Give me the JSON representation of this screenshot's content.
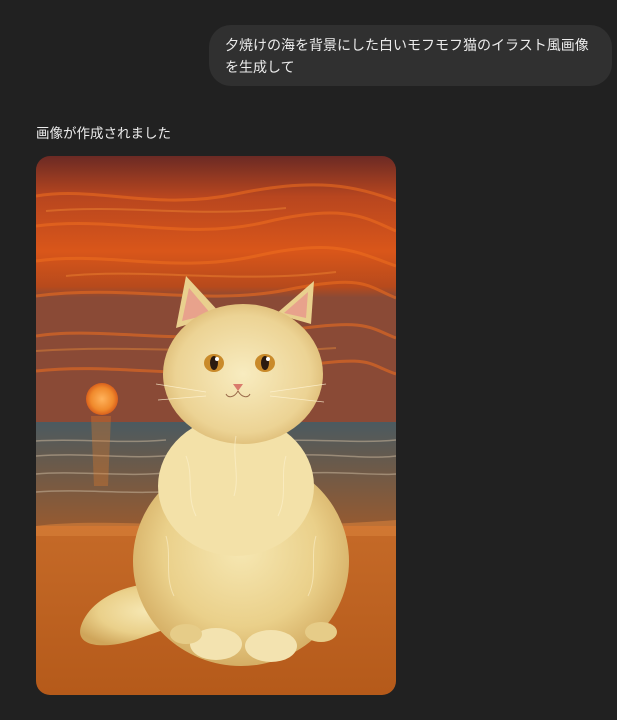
{
  "user_message": {
    "text": "夕焼けの海を背景にした白いモフモフ猫のイラスト風画像を生成して"
  },
  "assistant_message": {
    "status_text": "画像が作成されました"
  },
  "colors": {
    "page_background": "#212121",
    "bubble_background": "#303030",
    "text": "#ececec"
  }
}
